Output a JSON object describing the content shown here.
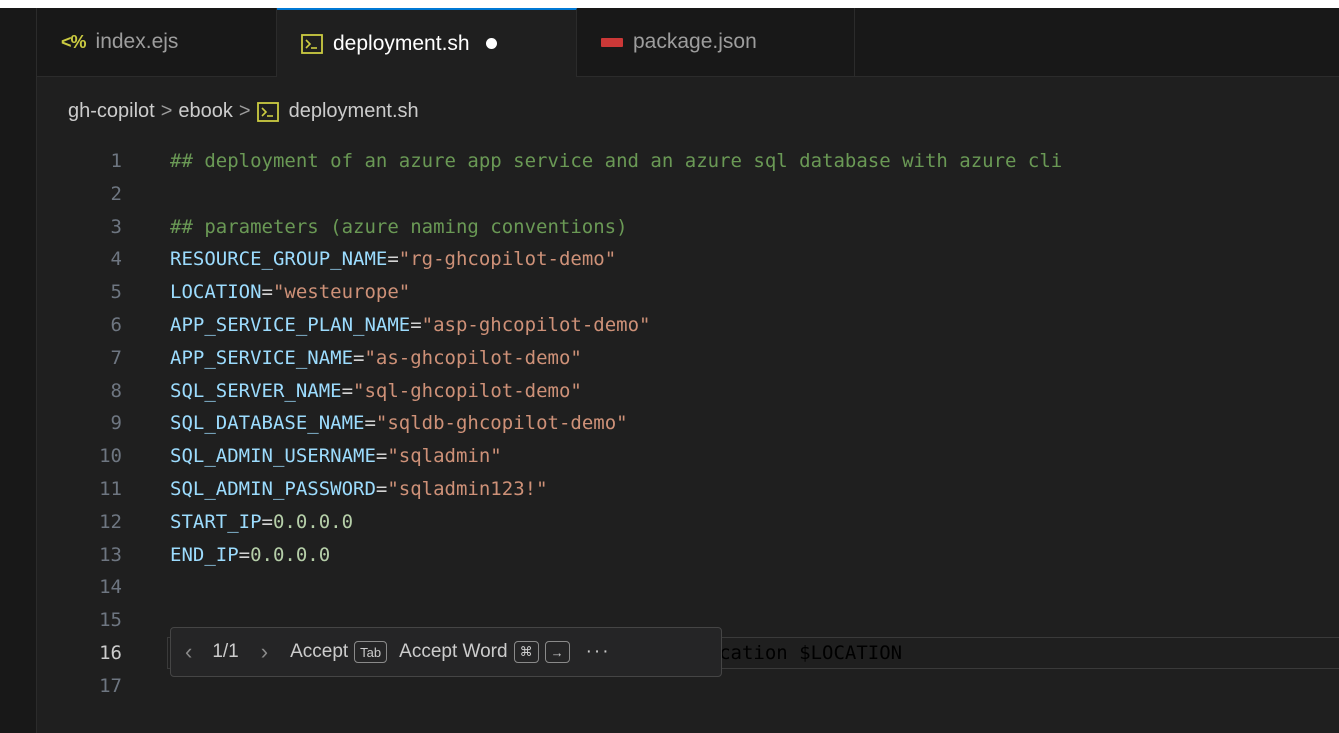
{
  "tabs": [
    {
      "label": "index.ejs",
      "icon": "ejs-file-icon",
      "icon_text": "<%",
      "active": false
    },
    {
      "label": "deployment.sh",
      "icon": "terminal-file-icon",
      "active": true,
      "modified": true
    },
    {
      "label": "package.json",
      "icon": "npm-file-icon",
      "active": false
    }
  ],
  "breadcrumb": {
    "items": [
      "gh-copilot",
      "ebook",
      "deployment.sh"
    ],
    "separator": ">"
  },
  "editor": {
    "lines": [
      {
        "n": "1",
        "parts": [
          {
            "t": "## deployment of an azure app service and an azure sql database with azure cli",
            "c": "comment"
          }
        ]
      },
      {
        "n": "2",
        "parts": []
      },
      {
        "n": "3",
        "parts": [
          {
            "t": "## parameters (azure naming conventions)",
            "c": "comment"
          }
        ]
      },
      {
        "n": "4",
        "parts": [
          {
            "t": "RESOURCE_GROUP_NAME",
            "c": "var"
          },
          {
            "t": "=",
            "c": "op"
          },
          {
            "t": "\"rg-ghcopilot-demo\"",
            "c": "str"
          }
        ]
      },
      {
        "n": "5",
        "parts": [
          {
            "t": "LOCATION",
            "c": "var"
          },
          {
            "t": "=",
            "c": "op"
          },
          {
            "t": "\"westeurope\"",
            "c": "str"
          }
        ]
      },
      {
        "n": "6",
        "parts": [
          {
            "t": "APP_SERVICE_PLAN_NAME",
            "c": "var"
          },
          {
            "t": "=",
            "c": "op"
          },
          {
            "t": "\"asp-ghcopilot-demo\"",
            "c": "str"
          }
        ]
      },
      {
        "n": "7",
        "parts": [
          {
            "t": "APP_SERVICE_NAME",
            "c": "var"
          },
          {
            "t": "=",
            "c": "op"
          },
          {
            "t": "\"as-ghcopilot-demo\"",
            "c": "str"
          }
        ]
      },
      {
        "n": "8",
        "parts": [
          {
            "t": "SQL_SERVER_NAME",
            "c": "var"
          },
          {
            "t": "=",
            "c": "op"
          },
          {
            "t": "\"sql-ghcopilot-demo\"",
            "c": "str"
          }
        ]
      },
      {
        "n": "9",
        "parts": [
          {
            "t": "SQL_DATABASE_NAME",
            "c": "var"
          },
          {
            "t": "=",
            "c": "op"
          },
          {
            "t": "\"sqldb-ghcopilot-demo\"",
            "c": "str"
          }
        ]
      },
      {
        "n": "10",
        "parts": [
          {
            "t": "SQL_ADMIN_USERNAME",
            "c": "var"
          },
          {
            "t": "=",
            "c": "op"
          },
          {
            "t": "\"sqladmin\"",
            "c": "str"
          }
        ]
      },
      {
        "n": "11",
        "parts": [
          {
            "t": "SQL_ADMIN_PASSWORD",
            "c": "var"
          },
          {
            "t": "=",
            "c": "op"
          },
          {
            "t": "\"sqladmin123!\"",
            "c": "str"
          }
        ]
      },
      {
        "n": "12",
        "parts": [
          {
            "t": "START_IP",
            "c": "var"
          },
          {
            "t": "=",
            "c": "op"
          },
          {
            "t": "0.0.0.0",
            "c": "num"
          }
        ]
      },
      {
        "n": "13",
        "parts": [
          {
            "t": "END_IP",
            "c": "var"
          },
          {
            "t": "=",
            "c": "op"
          },
          {
            "t": "0.0.0.0",
            "c": "num"
          }
        ]
      },
      {
        "n": "14",
        "parts": []
      },
      {
        "n": "15",
        "parts": []
      },
      {
        "n": "16",
        "parts": [
          {
            "t": "az group create --name $RESOURCE_GROUP_NAME --location $LOCATION",
            "c": "ghost"
          }
        ],
        "current": true
      },
      {
        "n": "17",
        "parts": []
      }
    ]
  },
  "suggestion_widget": {
    "prev_icon": "chevron-left-icon",
    "counter": "1/1",
    "next_icon": "chevron-right-icon",
    "accept_label": "Accept",
    "accept_key": "Tab",
    "accept_word_label": "Accept Word",
    "accept_word_keys": [
      "⌘",
      "→"
    ],
    "more_icon": "ellipsis-icon",
    "more_text": "···"
  },
  "colors": {
    "editor_bg": "#1f1f1f",
    "tab_active_border": "#0078d4",
    "comment": "#6a9955",
    "variable": "#9cdcfe",
    "string": "#ce9178",
    "number": "#b5cea8",
    "ghost_text": "#7a7a7a"
  }
}
